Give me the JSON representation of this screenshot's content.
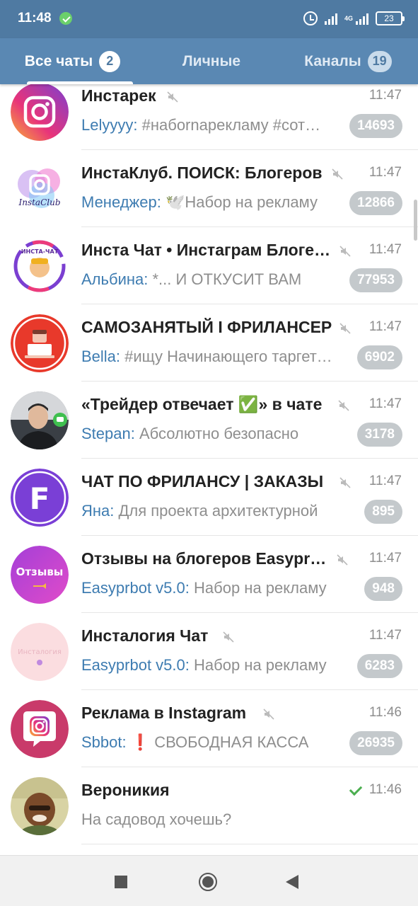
{
  "status_bar": {
    "time": "11:48",
    "net_type": "4G",
    "battery": "23"
  },
  "tabs": [
    {
      "label": "Все чаты",
      "badge": "2"
    },
    {
      "label": "Личные"
    },
    {
      "label": "Каналы",
      "badge": "19"
    }
  ],
  "chats": [
    {
      "title": "Инстарек",
      "sender": "Lelyyyy:",
      "message": " #набornарекламу #сотрудничество",
      "time": "11:47",
      "unread": "14693",
      "muted": true
    },
    {
      "title": "ИнстаКлуб. ПОИСК: Блогеров",
      "sender": "Менеджер:",
      "message": " 🕊️Набор на рекламу",
      "time": "11:47",
      "unread": "12866",
      "muted": true
    },
    {
      "title": "Инста Чат • Инстаграм Блогеры",
      "sender": "Альбина:",
      "message": " *... И ОТКУСИТ ВАМ",
      "time": "11:47",
      "unread": "77953",
      "muted": true
    },
    {
      "title": "САМОЗАНЯТЫЙ I ФРИЛАНСЕР",
      "sender": "Bella:",
      "message": " #ищу  Начинающего таргетолога",
      "time": "11:47",
      "unread": "6902",
      "muted": true
    },
    {
      "title": "«Трейдер отвечает ✅» в чате",
      "sender": "Stepan:",
      "message": " Абсолютно безопасно",
      "time": "11:47",
      "unread": "3178",
      "muted": true
    },
    {
      "title": "ЧАТ ПО ФРИЛАНСУ | ЗАКАЗЫ",
      "sender": "Яна:",
      "message": " Для проекта архитектурной",
      "time": "11:47",
      "unread": "895",
      "muted": true
    },
    {
      "title": "Отзывы на блогеров Easyprbot",
      "sender": "Easyprbot v5.0:",
      "message": " Набор на рекламу",
      "time": "11:47",
      "unread": "948",
      "muted": true
    },
    {
      "title": "Инсталогия Чат",
      "sender": "Easyprbot v5.0:",
      "message": " Набор на рекламу",
      "time": "11:47",
      "unread": "6283",
      "muted": true
    },
    {
      "title": "Реклама в Instagram",
      "sender": "Sbbot:",
      "message": " ❗ СВОБОДНАЯ КАССА",
      "time": "11:46",
      "unread": "26935",
      "muted": true
    },
    {
      "title": "Вероникия",
      "sender": "",
      "message": "На садовод хочешь?",
      "time": "11:46",
      "unread": "",
      "muted": false,
      "read": true
    }
  ],
  "avatars": {
    "instaclub_text": "InstaClub",
    "instachat_text": "ИНСТА-ЧАТ",
    "otzyvy_text": "Отзывы",
    "instalogia_text": "Инсталогия",
    "freelance_letter": "F"
  },
  "colors": {
    "header": "#4f7aa2",
    "tabs": "#5a88b3",
    "sender": "#3e7cb1",
    "badge_muted": "#c4c9cc",
    "read_check": "#4caf50"
  }
}
